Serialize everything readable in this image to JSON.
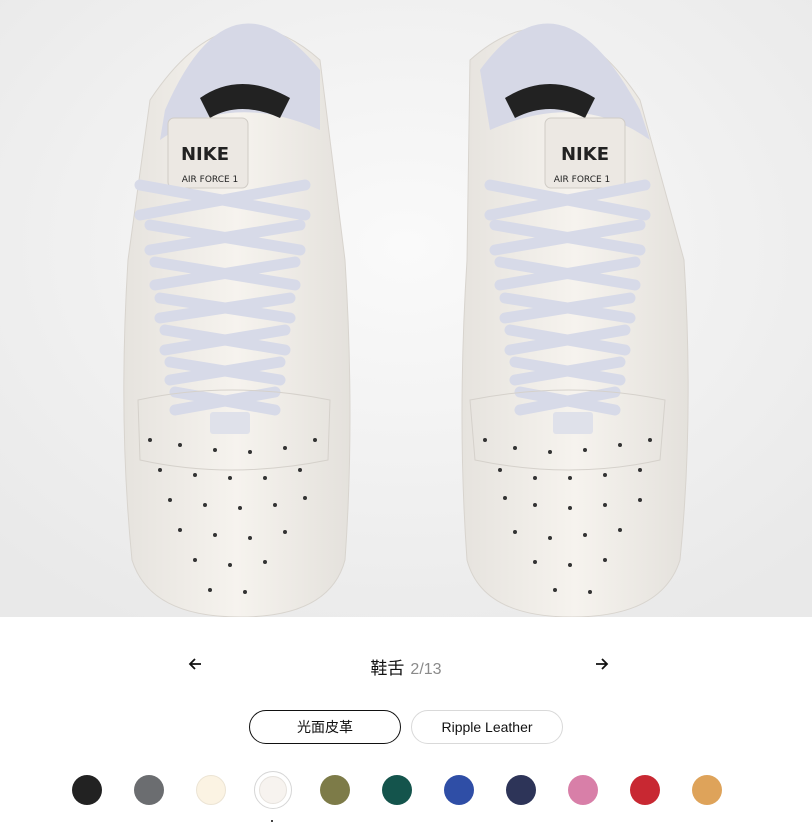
{
  "viewer": {
    "product_image": "sneaker-pair-top-view"
  },
  "part_selector": {
    "name": "鞋舌",
    "position": "2/13",
    "prev_icon": "arrow-left-icon",
    "next_icon": "arrow-right-icon"
  },
  "materials": [
    {
      "label": "光面皮革",
      "selected": true
    },
    {
      "label": "Ripple Leather",
      "selected": false
    }
  ],
  "colors": [
    {
      "hex": "#222222",
      "selected": false
    },
    {
      "hex": "#6b6d70",
      "selected": false
    },
    {
      "hex": "#fbf3e3",
      "selected": false
    },
    {
      "hex": "#f7f3ef",
      "selected": true
    },
    {
      "hex": "#7d7b48",
      "selected": false
    },
    {
      "hex": "#14544c",
      "selected": false
    },
    {
      "hex": "#2f4ea6",
      "selected": false
    },
    {
      "hex": "#2d3458",
      "selected": false
    },
    {
      "hex": "#d87fa8",
      "selected": false
    },
    {
      "hex": "#c82832",
      "selected": false
    },
    {
      "hex": "#dea35a",
      "selected": false
    }
  ]
}
